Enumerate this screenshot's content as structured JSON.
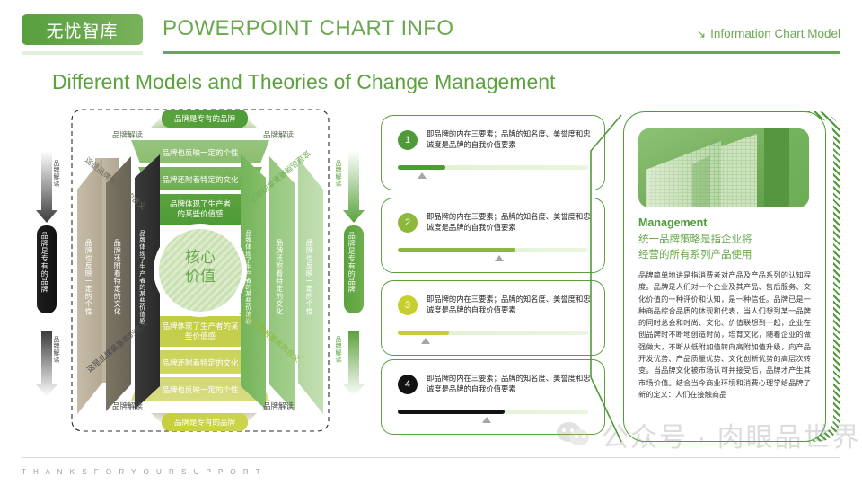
{
  "header": {
    "logo": "无忧智库",
    "title": "POWERPOINT CHART INFO",
    "right_label": "Information Chart Model",
    "right_icon": "arrow-down-right-icon"
  },
  "slide": {
    "title": "Different Models and Theories of Change Management"
  },
  "footer": {
    "thanks": "T H A N K S   F O R   Y O U R   S U P P O R T"
  },
  "watermark": {
    "text": "公众号 · 肉眼品世界",
    "icon": "wechat-icon"
  },
  "diagram": {
    "center": "核心\n价值",
    "center_line1": "核心",
    "center_line2": "价值",
    "top_pill": "品牌是专有的品牌",
    "bottom_pill": "品牌是专有的品牌",
    "left_pill": "品牌是专有的品牌",
    "right_pill": "品牌是专有的品牌",
    "caption_top_left": "品牌解读",
    "caption_top_right": "品牌解读",
    "caption_bottom_left": "品牌解读",
    "caption_bottom_right": "品牌解读",
    "caption_left_upper": "品牌解读",
    "caption_left_lower": "品牌解读",
    "caption_right_upper": "品牌解读",
    "caption_right_lower": "品牌解读",
    "diag_tl": "这是品牌最基本的含义",
    "diag_tr": "这是品牌最基本的含义",
    "diag_bl": "这是品牌最基本的含义",
    "diag_br": "这是品牌最基本的含义",
    "top_bars": [
      "品牌也反映一定的个性",
      "品牌还附着特定的文化",
      "品牌体现了生产者\n的某些价值感"
    ],
    "bottom_bars": [
      "品牌体现了生产者的某\n些价值感",
      "品牌还附着特定的文化",
      "品牌也反映一定的个性"
    ],
    "left_bars": [
      "品牌也反映一定的个性",
      "品牌还附着特定的文化",
      "品牌体现了生产者的某些价值感"
    ],
    "right_bars": [
      "品牌体现了生产者的某些价值感",
      "品牌还附着特定的文化",
      "品牌也反映一定的个性"
    ]
  },
  "cards": [
    {
      "num": "1",
      "text": "即品牌的内在三要素；品牌的知名度、美誉度和忠诚度是品牌的自我价值要素",
      "progress": 25,
      "num_color": "#4f9b38",
      "bar_color": "#4f9b38"
    },
    {
      "num": "2",
      "text": "即品牌的内在三要素；品牌的知名度、美誉度和忠诚度是品牌的自我价值要素",
      "progress": 62,
      "num_color": "#8cb83c",
      "bar_color": "#8cb83c"
    },
    {
      "num": "3",
      "text": "即品牌的内在三要素；品牌的知名度、美誉度和忠诚度是品牌的自我价值要素",
      "progress": 27,
      "num_color": "#c7cf2e",
      "bar_color": "#c7cf2e"
    },
    {
      "num": "4",
      "text": "即品牌的内在三要素；品牌的知名度、美誉度和忠诚度是品牌的自我价值要素",
      "progress": 56,
      "num_color": "#121212",
      "bar_color": "#121212"
    }
  ],
  "panel": {
    "image_alt": "glass-building-photo",
    "heading": "Management",
    "subheading": "统一品牌策略是指企业将\n经营的所有系列产品使用",
    "body": "品牌简单地讲是指消费者对产品及产品系列的认知程度。品牌是人们对一个企业及其产品、售后服务、文化价值的一种评价和认知，是一种信任。品牌已是一种商品综合品质的体现和代表，当人们想到某一品牌的同时总会和时尚、文化、价值联想到一起，企业在创品牌时不断地创造时尚，培育文化，随着企业的做强做大，不断从低附加值转向高附加值升级，向产品开发优势、产品质量优势、文化创新优势的高层次转变。当品牌文化被市场认可并接受后，品牌才产生其市场价值。结合当今商业环境和消费心理学给品牌了新的定义：人们在接触商品"
  },
  "colors": {
    "brand_green": "#6aa84f",
    "dark_green": "#4f9b38",
    "lime": "#c7cf2e",
    "olive": "#8cb83c",
    "taupe": "#b9ae94",
    "dark_taupe": "#6d675b",
    "black": "#272727"
  }
}
